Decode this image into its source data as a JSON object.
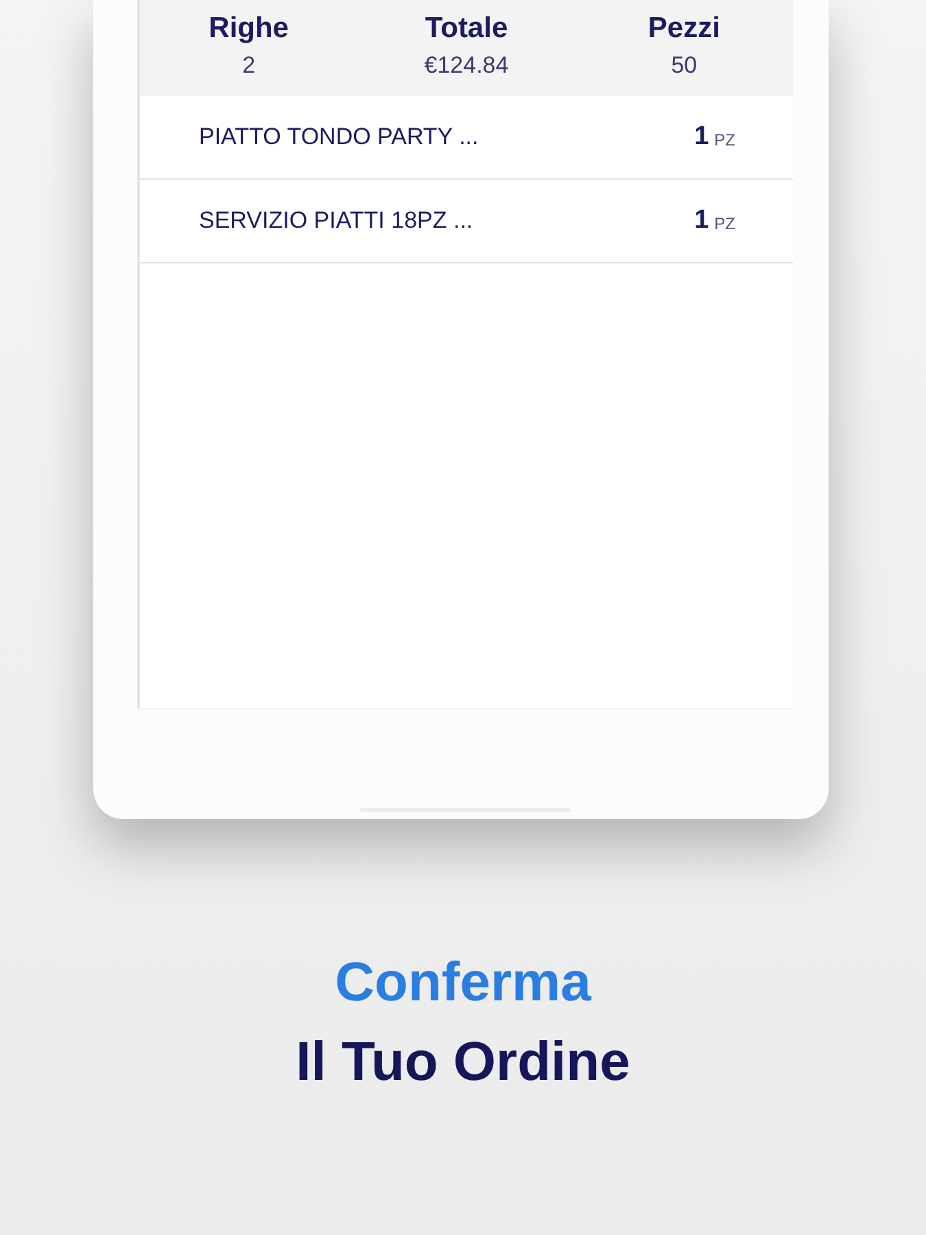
{
  "summary": [
    {
      "label": "Righe",
      "value": "2"
    },
    {
      "label": "Totale",
      "value": "€124.84"
    },
    {
      "label": "Pezzi",
      "value": "50"
    }
  ],
  "items": [
    {
      "name": "PIATTO TONDO PARTY ...",
      "quantity": "1",
      "unit": "PZ"
    },
    {
      "name": "SERVIZIO PIATTI 18PZ ...",
      "quantity": "1",
      "unit": "PZ"
    }
  ],
  "caption": {
    "highlight": "Conferma",
    "subtitle": "Il Tuo Ordine"
  }
}
